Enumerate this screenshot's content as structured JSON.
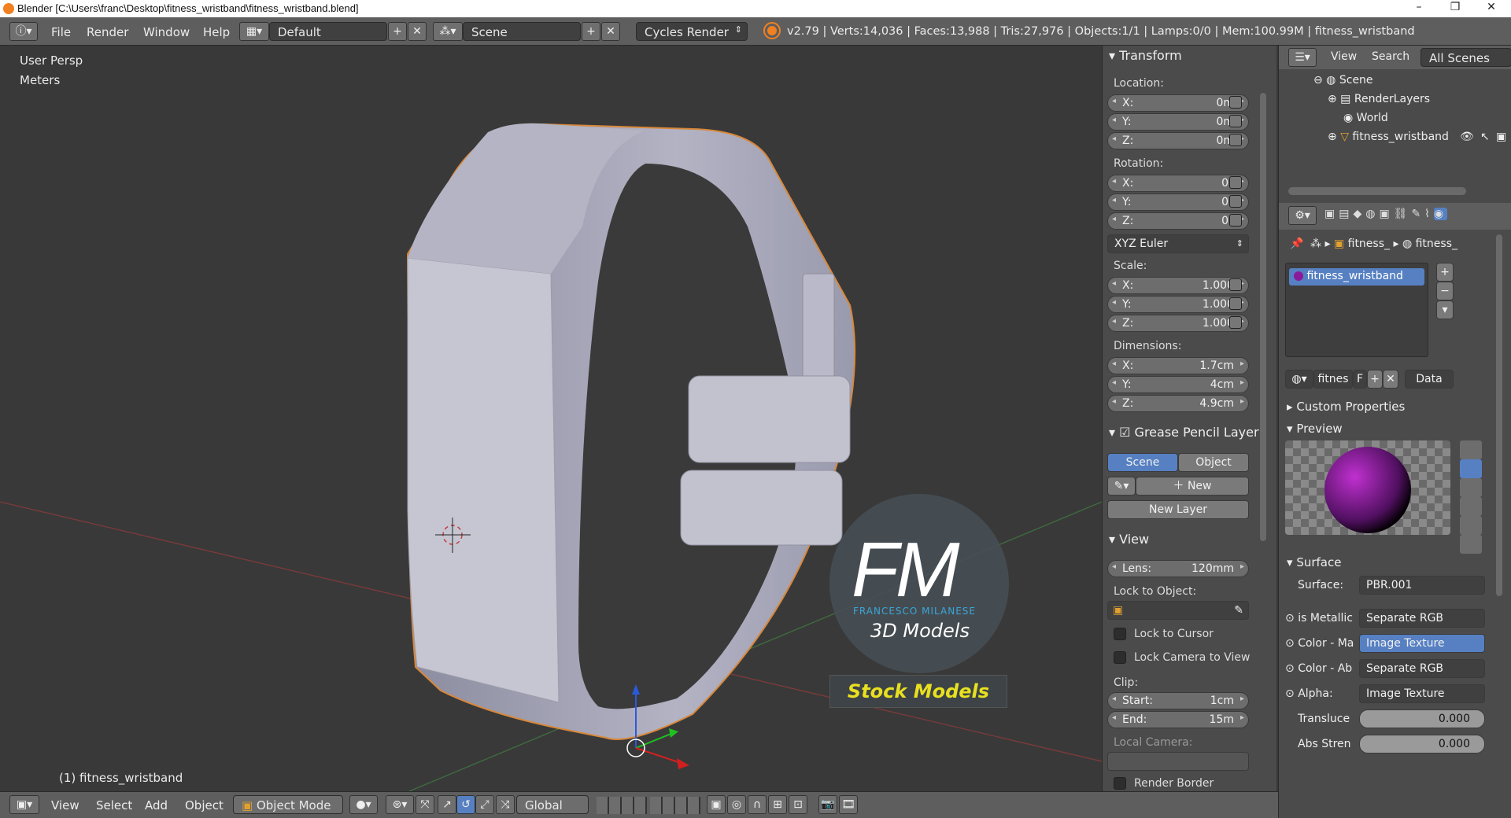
{
  "window": {
    "title": "Blender [C:\\Users\\franc\\Desktop\\fitness_wristband\\fitness_wristband.blend]",
    "controls": [
      "–",
      "❐",
      "✕"
    ]
  },
  "info_header": {
    "menus": [
      "File",
      "Render",
      "Window",
      "Help"
    ],
    "screen_layout": "Default",
    "scene": "Scene",
    "engine": "Cycles Render",
    "stats": "v2.79 | Verts:14,036 | Faces:13,988 | Tris:27,976 | Objects:1/1 | Lamps:0/0 | Mem:100.99M | fitness_wristband"
  },
  "viewport": {
    "view_name": "User Persp",
    "units": "Meters",
    "object_label": "(1) fitness_wristband",
    "watermark": {
      "big": "FM",
      "name": "FRANCESCO MILANESE",
      "sub": "3D Models",
      "badge": "Stock Models"
    }
  },
  "n_panel": {
    "transform_title": "Transform",
    "location_label": "Location:",
    "location": [
      {
        "axis": "X:",
        "value": "0m"
      },
      {
        "axis": "Y:",
        "value": "0m"
      },
      {
        "axis": "Z:",
        "value": "0m"
      }
    ],
    "rotation_label": "Rotation:",
    "rotation": [
      {
        "axis": "X:",
        "value": "0°"
      },
      {
        "axis": "Y:",
        "value": "0°"
      },
      {
        "axis": "Z:",
        "value": "0°"
      }
    ],
    "rotation_mode": "XYZ Euler",
    "scale_label": "Scale:",
    "scale": [
      {
        "axis": "X:",
        "value": "1.000"
      },
      {
        "axis": "Y:",
        "value": "1.000"
      },
      {
        "axis": "Z:",
        "value": "1.000"
      }
    ],
    "dimensions_label": "Dimensions:",
    "dimensions": [
      {
        "axis": "X:",
        "value": "1.7cm"
      },
      {
        "axis": "Y:",
        "value": "4cm"
      },
      {
        "axis": "Z:",
        "value": "4.9cm"
      }
    ],
    "grease_title": "Grease Pencil Layer",
    "gp_scene": "Scene",
    "gp_object": "Object",
    "gp_new": "New",
    "gp_new_layer": "New Layer",
    "view_title": "View",
    "lens_label": "Lens:",
    "lens_value": "120mm",
    "lock_to_object": "Lock to Object:",
    "lock_to_cursor": "Lock to Cursor",
    "lock_camera": "Lock Camera to View",
    "clip_label": "Clip:",
    "clip_start_label": "Start:",
    "clip_start": "1cm",
    "clip_end_label": "End:",
    "clip_end": "15m",
    "local_camera": "Local Camera:",
    "render_border": "Render Border"
  },
  "outliner": {
    "view": "View",
    "search": "Search",
    "filter": "All Scenes",
    "items": [
      "Scene",
      "RenderLayers",
      "World",
      "fitness_wristband"
    ]
  },
  "properties": {
    "breadcrumb": [
      "fitness_",
      "fitness_"
    ],
    "material_slot": "fitness_wristband",
    "mat_name": "fitnes",
    "mat_f": "F",
    "link": "Data",
    "custom_properties": "Custom Properties",
    "preview": "Preview",
    "surface_title": "Surface",
    "surface_label": "Surface:",
    "surface_value": "PBR.001",
    "inputs": [
      {
        "label": "is Metallic",
        "value": "Separate RGB"
      },
      {
        "label": "Color - Ma",
        "value": "Image Texture"
      },
      {
        "label": "Color - Ab",
        "value": "Separate RGB"
      },
      {
        "label": "Alpha:",
        "value": "Image Texture"
      }
    ],
    "sliders": [
      {
        "label": "Transluce",
        "value": "0.000"
      },
      {
        "label": "Abs Stren",
        "value": "0.000"
      }
    ]
  },
  "bottom_bar": {
    "menus": [
      "View",
      "Select",
      "Add",
      "Object"
    ],
    "mode": "Object Mode",
    "orientation": "Global"
  },
  "colors": {
    "selection": "#5680c2",
    "header": "#5e5e5e",
    "viewport": "#393939",
    "accent_orange": "#f08020"
  }
}
